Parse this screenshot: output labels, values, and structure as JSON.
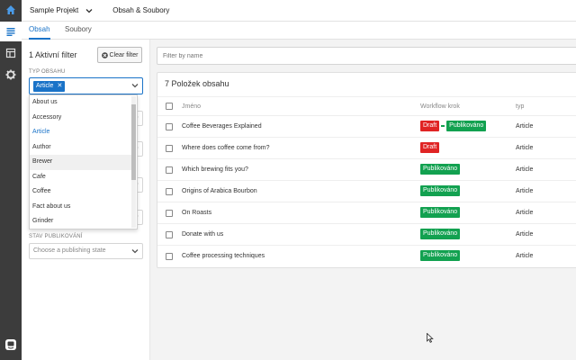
{
  "colors": {
    "accent": "#1a73c8",
    "draft": "#e02424",
    "published": "#12a150",
    "rail": "#3c3c3c"
  },
  "rail": {
    "icons": [
      "home-icon",
      "content-list-icon",
      "layout-icon",
      "gear-icon",
      "chat-icon"
    ]
  },
  "topbar": {
    "project": "Sample Projekt",
    "section": "Obsah & Soubory"
  },
  "tabs": [
    {
      "label": "Obsah",
      "active": true
    },
    {
      "label": "Soubory",
      "active": false
    }
  ],
  "filters": {
    "count_label": "1 Aktivní filter",
    "clear_label": "Clear filter",
    "type_label": "TYP OBSAHU",
    "selected_chip": "Article",
    "publish_label": "STAV PUBLIKOVÁNÍ",
    "publish_placeholder": "Choose a publishing state"
  },
  "dropdown": {
    "items": [
      "About us",
      "Accessory",
      "Article",
      "Author",
      "Brewer",
      "Cafe",
      "Coffee",
      "Fact about us",
      "Grinder"
    ],
    "selected": "Article",
    "hovered": "Brewer"
  },
  "search": {
    "placeholder": "Filter by name"
  },
  "content": {
    "title": "7 Položek obsahu",
    "columns": {
      "name": "Jméno",
      "workflow": "Workflow krok",
      "type": "typ"
    },
    "rows": [
      {
        "name": "Coffee Beverages Explained",
        "steps": [
          "Draft",
          "Publikováno"
        ],
        "type": "Article"
      },
      {
        "name": "Where does coffee come from?",
        "steps": [
          "Draft"
        ],
        "type": "Article"
      },
      {
        "name": "Which brewing fits you?",
        "steps": [
          "Publikováno"
        ],
        "type": "Article"
      },
      {
        "name": "Origins of Arabica Bourbon",
        "steps": [
          "Publikováno"
        ],
        "type": "Article"
      },
      {
        "name": "On Roasts",
        "steps": [
          "Publikováno"
        ],
        "type": "Article"
      },
      {
        "name": "Donate with us",
        "steps": [
          "Publikováno"
        ],
        "type": "Article"
      },
      {
        "name": "Coffee processing techniques",
        "steps": [
          "Publikováno"
        ],
        "type": "Article"
      }
    ]
  }
}
